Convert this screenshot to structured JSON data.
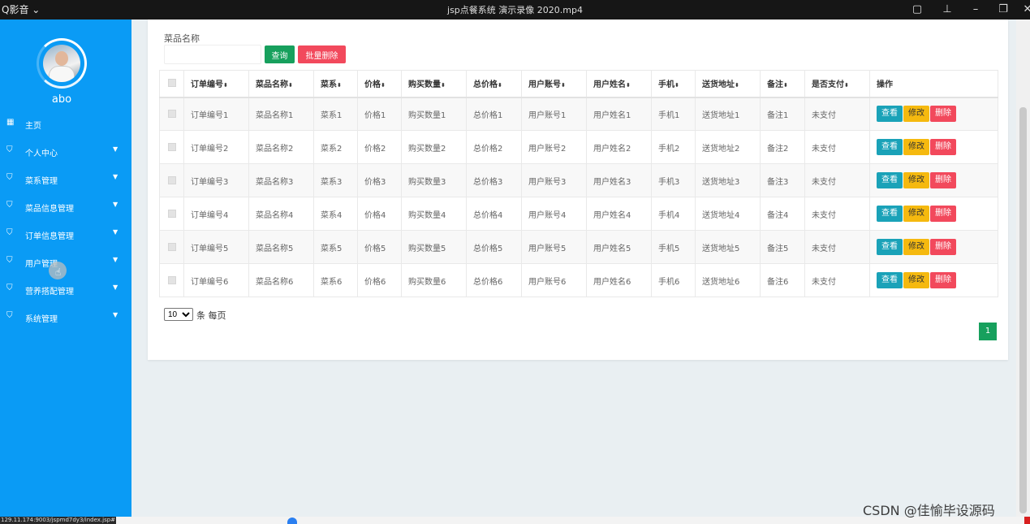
{
  "player": {
    "app_name": "Q影音",
    "video_title": "jsp点餐系统 演示录像 2020.mp4"
  },
  "sidebar": {
    "username": "abo",
    "items": [
      {
        "label": "主页",
        "icon": "home-icon",
        "has_chevron": false
      },
      {
        "label": "个人中心",
        "icon": "shield-icon",
        "has_chevron": true
      },
      {
        "label": "菜系管理",
        "icon": "shield-icon",
        "has_chevron": true
      },
      {
        "label": "菜品信息管理",
        "icon": "shield-icon",
        "has_chevron": true
      },
      {
        "label": "订单信息管理",
        "icon": "shield-icon",
        "has_chevron": true
      },
      {
        "label": "用户管理",
        "icon": "shield-icon",
        "has_chevron": true
      },
      {
        "label": "营养搭配管理",
        "icon": "shield-icon",
        "has_chevron": true
      },
      {
        "label": "系统管理",
        "icon": "shield-icon",
        "has_chevron": true
      }
    ]
  },
  "search": {
    "label": "菜品名称",
    "value": "",
    "query_button": "查询",
    "batch_delete_button": "批量删除"
  },
  "table": {
    "columns": [
      "订单编号",
      "菜品名称",
      "菜系",
      "价格",
      "购买数量",
      "总价格",
      "用户账号",
      "用户姓名",
      "手机",
      "送货地址",
      "备注",
      "是否支付",
      "操作"
    ],
    "rows": [
      [
        "订单编号1",
        "菜品名称1",
        "菜系1",
        "价格1",
        "购买数量1",
        "总价格1",
        "用户账号1",
        "用户姓名1",
        "手机1",
        "送货地址1",
        "备注1",
        "未支付"
      ],
      [
        "订单编号2",
        "菜品名称2",
        "菜系2",
        "价格2",
        "购买数量2",
        "总价格2",
        "用户账号2",
        "用户姓名2",
        "手机2",
        "送货地址2",
        "备注2",
        "未支付"
      ],
      [
        "订单编号3",
        "菜品名称3",
        "菜系3",
        "价格3",
        "购买数量3",
        "总价格3",
        "用户账号3",
        "用户姓名3",
        "手机3",
        "送货地址3",
        "备注3",
        "未支付"
      ],
      [
        "订单编号4",
        "菜品名称4",
        "菜系4",
        "价格4",
        "购买数量4",
        "总价格4",
        "用户账号4",
        "用户姓名4",
        "手机4",
        "送货地址4",
        "备注4",
        "未支付"
      ],
      [
        "订单编号5",
        "菜品名称5",
        "菜系5",
        "价格5",
        "购买数量5",
        "总价格5",
        "用户账号5",
        "用户姓名5",
        "手机5",
        "送货地址5",
        "备注5",
        "未支付"
      ],
      [
        "订单编号6",
        "菜品名称6",
        "菜系6",
        "价格6",
        "购买数量6",
        "总价格6",
        "用户账号6",
        "用户姓名6",
        "手机6",
        "送货地址6",
        "备注6",
        "未支付"
      ]
    ],
    "actions": {
      "view": "查看",
      "edit": "修改",
      "delete": "删除"
    }
  },
  "pagination": {
    "page_size": "10",
    "page_size_options": [
      "10"
    ],
    "page_size_suffix": "条 每页",
    "current_page": "1"
  },
  "status_url": "129.11.174:9003/jspmd7dy3/index.jsp#",
  "watermark": "CSDN @佳愉毕设源码",
  "colors": {
    "sidebar": "#0a9bf5",
    "query": "#17a05d",
    "danger": "#f2495c",
    "view": "#1aa2b8",
    "edit": "#f5b90f"
  }
}
